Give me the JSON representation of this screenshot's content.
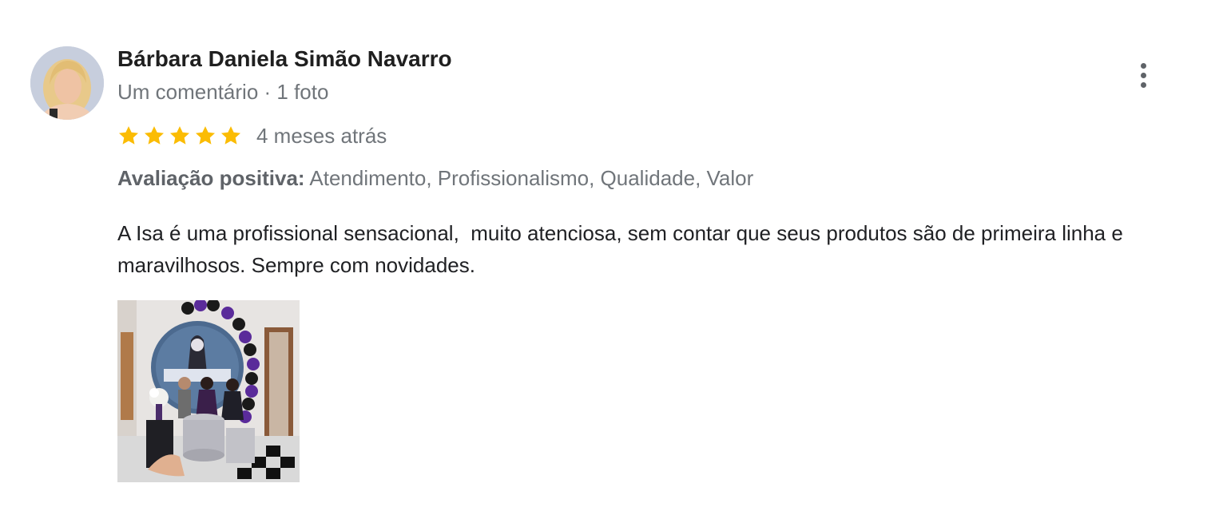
{
  "reviewer": {
    "name": "Bárbara Daniela Simão Navarro",
    "meta": "Um comentário · 1 foto"
  },
  "rating": {
    "stars": 5,
    "max": 5,
    "star_color": "#fbbc04",
    "date": "4 meses atrás"
  },
  "highlights": {
    "label": "Avaliação positiva:",
    "values": "Atendimento, Profissionalismo, Qualidade, Valor"
  },
  "review_text": "A Isa é uma profissional sensacional,  muito atenciosa, sem contar que seus produtos são de primeira linha e maravilhosos. Sempre com novidades.",
  "icons": {
    "more": "more-vertical-icon",
    "star": "star-icon"
  }
}
